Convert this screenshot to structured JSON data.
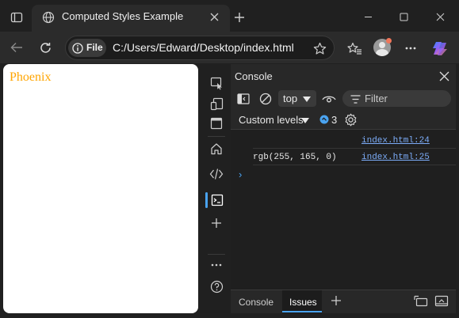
{
  "browser": {
    "tab_title": "Computed Styles Example",
    "address": {
      "scheme_label": "File",
      "url": "C:/Users/Edward/Desktop/index.html"
    }
  },
  "page": {
    "text": "Phoenix",
    "text_color": "#ffa500"
  },
  "devtools": {
    "panel_title": "Console",
    "context": "top",
    "filter_placeholder": "Filter",
    "levels": "Custom levels",
    "issue_count": "3",
    "log": [
      {
        "text": "",
        "source": "index.html:24"
      },
      {
        "text": "rgb(255, 165, 0)",
        "source": "index.html:25"
      }
    ],
    "prompt": "›",
    "drawer_tabs": [
      "Console",
      "Issues"
    ],
    "active_drawer_tab": "Issues"
  },
  "colors": {
    "accent": "#4aa3f0",
    "link": "#7cacf8"
  }
}
